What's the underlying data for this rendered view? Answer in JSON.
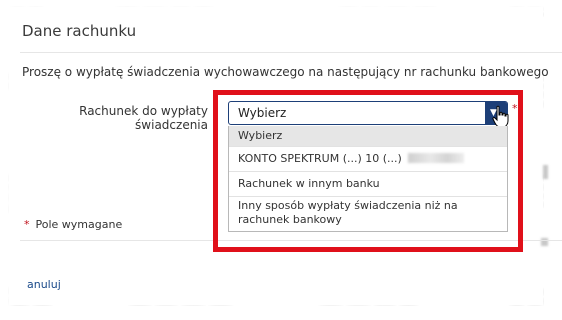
{
  "section": {
    "title": "Dane rachunku",
    "description": "Proszę o wypłatę świadczenia wychowawczego na następujący nr rachunku bankowego"
  },
  "account_field": {
    "label_line1": "Rachunek do wypłaty",
    "label_line2": "świadczenia",
    "required_marker": "*",
    "selected_value": "Wybierz",
    "options": [
      {
        "label": "Wybierz",
        "selected": true
      },
      {
        "label": "KONTO SPEKTRUM (...) 10 (...)",
        "selected": false
      },
      {
        "label": "Rachunek w innym banku",
        "selected": false
      },
      {
        "label_line1": "Inny sposób wypłaty świadczenia niż na",
        "label_line2": "rachunek bankowy",
        "selected": false
      }
    ]
  },
  "footer": {
    "required_marker": "*",
    "required_note": "Pole wymagane",
    "cancel_label": "anuluj"
  },
  "colors": {
    "accent": "#1d3f78",
    "highlight": "#e0101a",
    "required": "#c0131d",
    "link": "#1a4a8a"
  }
}
